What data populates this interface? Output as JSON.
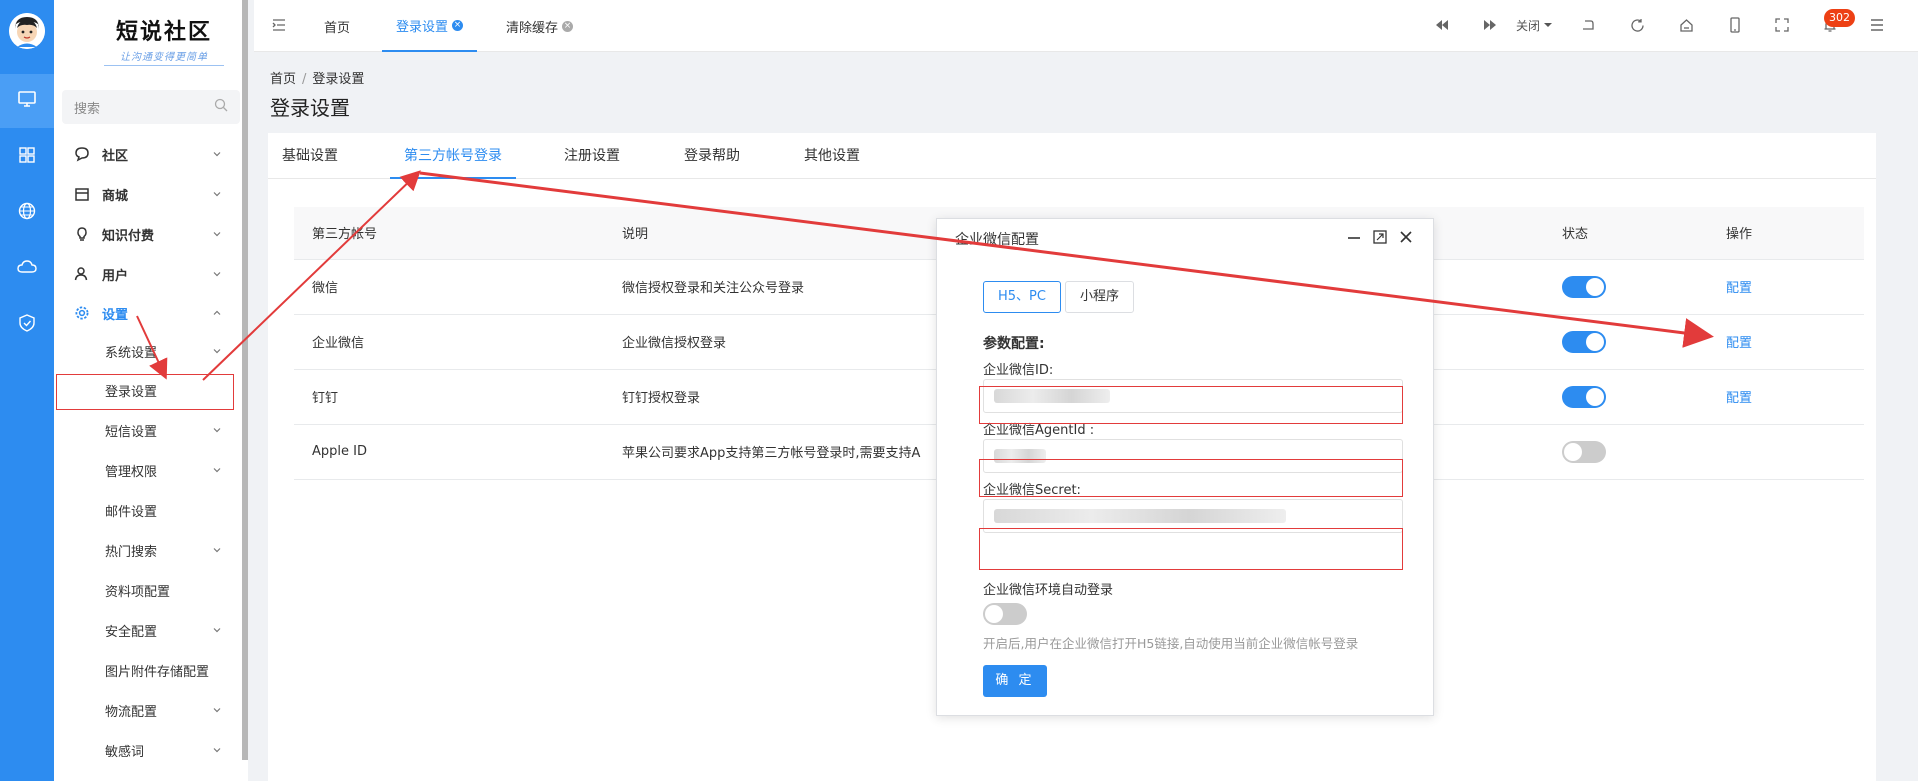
{
  "sidebar": {
    "logo_name": "短说社区",
    "logo_slogan": "让沟通变得更简单",
    "search_placeholder": "搜索",
    "menu": [
      {
        "label": "社区",
        "icon": "chat-icon"
      },
      {
        "label": "商城",
        "icon": "shop-icon"
      },
      {
        "label": "知识付费",
        "icon": "bulb-icon"
      },
      {
        "label": "用户",
        "icon": "user-icon"
      },
      {
        "label": "设置",
        "icon": "gear-icon"
      }
    ],
    "sub_items": [
      {
        "label": "系统设置"
      },
      {
        "label": "登录设置"
      },
      {
        "label": "短信设置"
      },
      {
        "label": "管理权限"
      },
      {
        "label": "邮件设置"
      },
      {
        "label": "热门搜索"
      },
      {
        "label": "资料项配置"
      },
      {
        "label": "安全配置"
      },
      {
        "label": "图片附件存储配置"
      },
      {
        "label": "物流配置"
      },
      {
        "label": "敏感词"
      }
    ]
  },
  "topbar": {
    "tabs": [
      {
        "label": "首页"
      },
      {
        "label": "登录设置"
      },
      {
        "label": "清除缓存"
      }
    ],
    "close_label": "关闭",
    "notification_count": "302"
  },
  "breadcrumb": {
    "home": "首页",
    "sep": "/",
    "current": "登录设置"
  },
  "page_title": "登录设置",
  "card_tabs": [
    {
      "label": "基础设置"
    },
    {
      "label": "第三方帐号登录"
    },
    {
      "label": "注册设置"
    },
    {
      "label": "登录帮助"
    },
    {
      "label": "其他设置"
    }
  ],
  "table": {
    "headers": {
      "account": "第三方帐号",
      "desc": "说明",
      "status": "状态",
      "action": "操作"
    },
    "rows": [
      {
        "account": "微信",
        "desc": "微信授权登录和关注公众号登录",
        "status": true,
        "action": "配置"
      },
      {
        "account": "企业微信",
        "desc": "企业微信授权登录",
        "status": true,
        "action": "配置"
      },
      {
        "account": "钉钉",
        "desc": "钉钉授权登录",
        "status": true,
        "action": "配置"
      },
      {
        "account": "Apple ID",
        "desc": "苹果公司要求App支持第三方帐号登录时,需要支持A",
        "status": false,
        "action": ""
      }
    ]
  },
  "modal": {
    "title": "企业微信配置",
    "tabs": [
      {
        "label": "H5、PC"
      },
      {
        "label": "小程序"
      }
    ],
    "section": "参数配置:",
    "fields": [
      {
        "label": "企业微信ID:"
      },
      {
        "label": "企业微信AgentId :"
      },
      {
        "label": "企业微信Secret:"
      }
    ],
    "toggle_label": "企业微信环境自动登录",
    "hint": "开启后,用户在企业微信打开H5链接,自动使用当前企业微信帐号登录",
    "ok_label": "确 定"
  },
  "colors": {
    "primary": "#2d8cf0",
    "annotation": "#e23b3b",
    "badge": "#ed4014"
  }
}
